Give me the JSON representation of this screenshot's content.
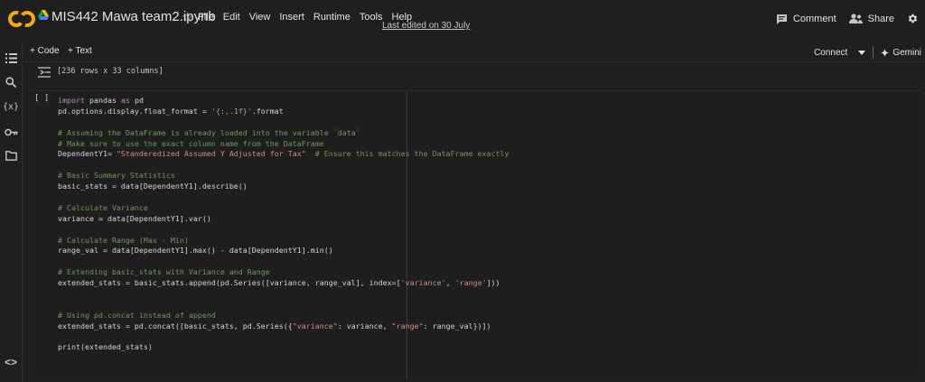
{
  "header": {
    "title": "MIS442 Mawa team2.ipynb",
    "menu": [
      "File",
      "Edit",
      "View",
      "Insert",
      "Runtime",
      "Tools",
      "Help"
    ],
    "last_edited": "Last edited on 30 July",
    "comment_label": "Comment",
    "share_label": "Share"
  },
  "toolbar": {
    "add_code": "+ Code",
    "add_text": "+ Text",
    "connect": "Connect",
    "gemini": "Gemini"
  },
  "output": {
    "text": "[236 rows x 33 columns]"
  },
  "cell": {
    "run_label": "[ ]"
  },
  "icons": [
    "colab-logo",
    "drive-icon",
    "star-icon",
    "comment-icon",
    "share-icon",
    "gear-icon",
    "toc-icon",
    "search-icon",
    "variables-icon",
    "secrets-icon",
    "folder-icon",
    "code-snippets-icon",
    "output-icon",
    "chevron-down-icon",
    "sparkle-icon"
  ],
  "colors": {
    "accent": "#f9ab00",
    "background": "#1f1f1f",
    "comment": "#6a9955",
    "string": "#ce9178",
    "keyword": "#c586c0"
  },
  "code_lines": [
    [
      {
        "t": "import",
        "c": "kw"
      },
      {
        "t": " pandas "
      },
      {
        "t": "as",
        "c": "kw"
      },
      {
        "t": " pd"
      }
    ],
    [
      {
        "t": "pd.options.display.float_format = "
      },
      {
        "t": "'{:,.1f}'",
        "c": "st"
      },
      {
        "t": ".format"
      }
    ],
    [],
    [
      {
        "t": "# Assuming the DataFrame is already loaded into the variable `data`",
        "c": "cm"
      }
    ],
    [
      {
        "t": "# Make sure to use the exact column name from the DataFrame",
        "c": "cm"
      }
    ],
    [
      {
        "t": "DependentY1= "
      },
      {
        "t": "\"Standeredized Assumed Y Adjusted for Tax\"",
        "c": "st"
      },
      {
        "t": "  "
      },
      {
        "t": "# Ensure this matches the DataFrame exactly",
        "c": "cm"
      }
    ],
    [],
    [
      {
        "t": "# Basic Summary Statistics",
        "c": "cm"
      }
    ],
    [
      {
        "t": "basic_stats = data[DependentY1].describe()"
      }
    ],
    [],
    [
      {
        "t": "# Calculate Variance",
        "c": "cm"
      }
    ],
    [
      {
        "t": "variance = data[DependentY1].var()"
      }
    ],
    [],
    [
      {
        "t": "# Calculate Range (Max - Min)",
        "c": "cm"
      }
    ],
    [
      {
        "t": "range_val = data[DependentY1].max() - data[DependentY1].min()"
      }
    ],
    [],
    [
      {
        "t": "# Extending basic_stats with Variance and Range",
        "c": "cm"
      }
    ],
    [
      {
        "t": "extended_stats = basic_stats.append(pd.Series([variance, range_val], index=["
      },
      {
        "t": "'variance'",
        "c": "st"
      },
      {
        "t": ", "
      },
      {
        "t": "'range'",
        "c": "st"
      },
      {
        "t": "]))"
      }
    ],
    [],
    [],
    [
      {
        "t": "# Using pd.concat instead of append",
        "c": "cm"
      }
    ],
    [
      {
        "t": "extended_stats = pd.concat([basic_stats, pd.Series({"
      },
      {
        "t": "\"variance\"",
        "c": "st"
      },
      {
        "t": ": variance, "
      },
      {
        "t": "\"range\"",
        "c": "st"
      },
      {
        "t": ": range_val})])"
      }
    ],
    [],
    [
      {
        "t": "print(extended_stats)"
      }
    ]
  ]
}
